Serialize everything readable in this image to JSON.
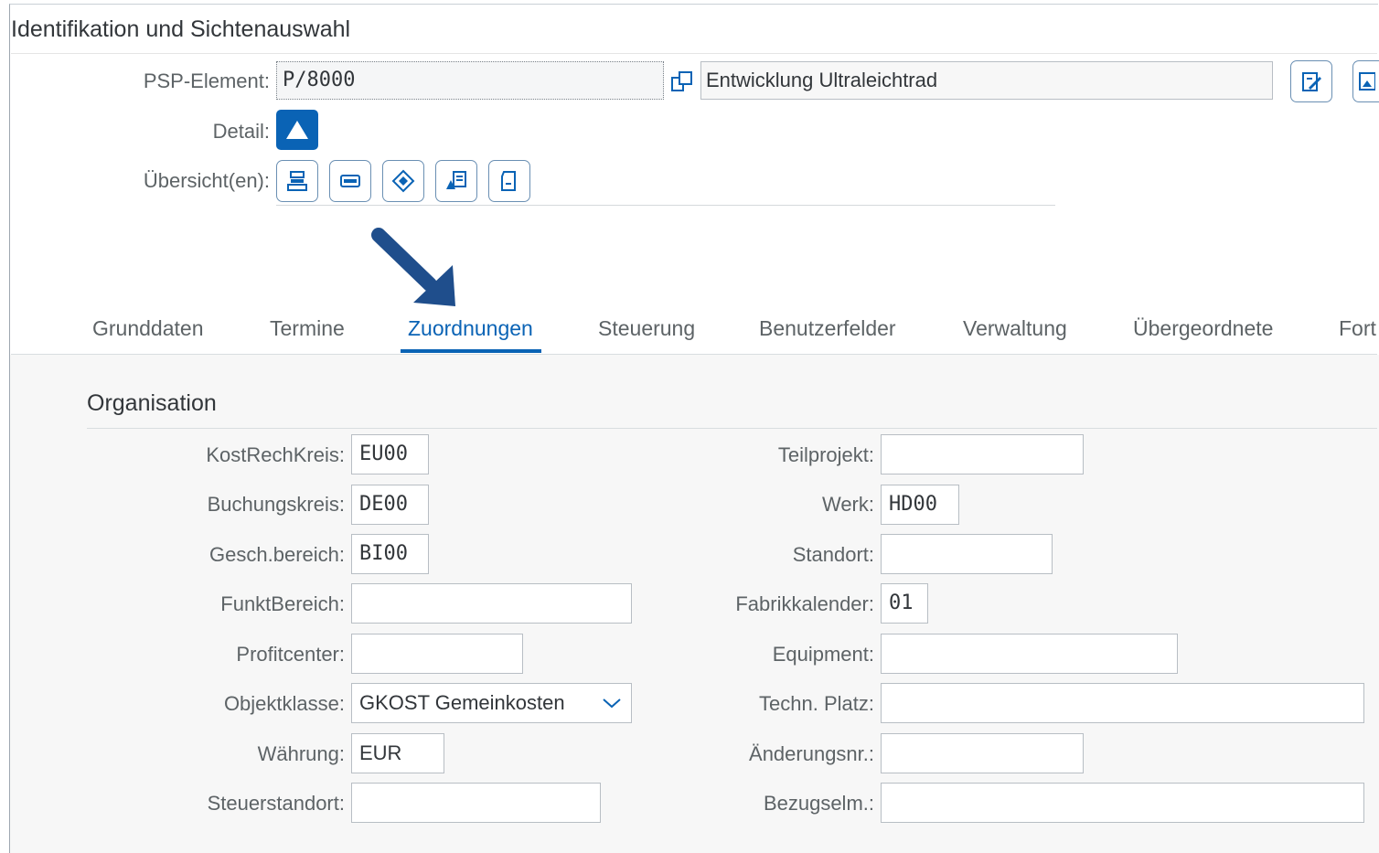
{
  "header": {
    "title": "Identifikation und Sichtenauswahl",
    "psp_label": "PSP-Element:",
    "psp_value": "P/8000",
    "psp_description": "Entwicklung Ultraleichtrad",
    "detail_label": "Detail:",
    "overview_label": "Übersicht(en):"
  },
  "tabs": [
    {
      "label": "Grunddaten"
    },
    {
      "label": "Termine"
    },
    {
      "label": "Zuordnungen",
      "active": true
    },
    {
      "label": "Steuerung"
    },
    {
      "label": "Benutzerfelder"
    },
    {
      "label": "Verwaltung"
    },
    {
      "label": "Übergeordnete"
    },
    {
      "label": "Fort"
    }
  ],
  "organisation": {
    "title": "Organisation",
    "left": [
      {
        "label": "KostRechKreis:",
        "value": "EU00"
      },
      {
        "label": "Buchungskreis:",
        "value": "DE00"
      },
      {
        "label": "Gesch.bereich:",
        "value": "BI00"
      },
      {
        "label": "FunktBereich:",
        "value": ""
      },
      {
        "label": "Profitcenter:",
        "value": ""
      },
      {
        "label": "Objektklasse:",
        "value": "GKOST Gemeinkosten"
      },
      {
        "label": "Währung:",
        "value": "EUR"
      },
      {
        "label": "Steuerstandort:",
        "value": ""
      }
    ],
    "right": [
      {
        "label": "Teilprojekt:",
        "value": ""
      },
      {
        "label": "Werk:",
        "value": "HD00"
      },
      {
        "label": "Standort:",
        "value": ""
      },
      {
        "label": "Fabrikkalender:",
        "value": "01"
      },
      {
        "label": "Equipment:",
        "value": ""
      },
      {
        "label": "Techn. Platz:",
        "value": ""
      },
      {
        "label": "Änderungsnr.:",
        "value": ""
      },
      {
        "label": "Bezugselm.:",
        "value": ""
      }
    ]
  },
  "colors": {
    "accent": "#0a63b5",
    "arrow": "#1f4e8c",
    "content_bg": "#f7f7f7"
  }
}
